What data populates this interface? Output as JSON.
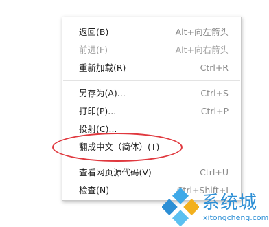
{
  "menu": {
    "items": [
      {
        "label": "返回(B)",
        "shortcut": "Alt+向左箭头",
        "disabled": false
      },
      {
        "label": "前进(F)",
        "shortcut": "Alt+向右箭头",
        "disabled": true
      },
      {
        "label": "重新加载(R)",
        "shortcut": "Ctrl+R",
        "disabled": false
      },
      {
        "label": "另存为(A)...",
        "shortcut": "Ctrl+S",
        "disabled": false
      },
      {
        "label": "打印(P)...",
        "shortcut": "Ctrl+P",
        "disabled": false
      },
      {
        "label": "投射(C)...",
        "shortcut": "",
        "disabled": false
      },
      {
        "label": "翻成中文（简体）(T)",
        "shortcut": "",
        "disabled": false
      },
      {
        "label": "查看网页源代码(V)",
        "shortcut": "Ctrl+U",
        "disabled": false
      },
      {
        "label": "检查(N)",
        "shortcut": "Ctrl+Shift+I",
        "disabled": false
      }
    ]
  },
  "annotation": {
    "color": "#e0383e"
  },
  "watermark": {
    "title": "系统城",
    "url": "xitongcheng.com",
    "color": "#2d8fd5"
  }
}
